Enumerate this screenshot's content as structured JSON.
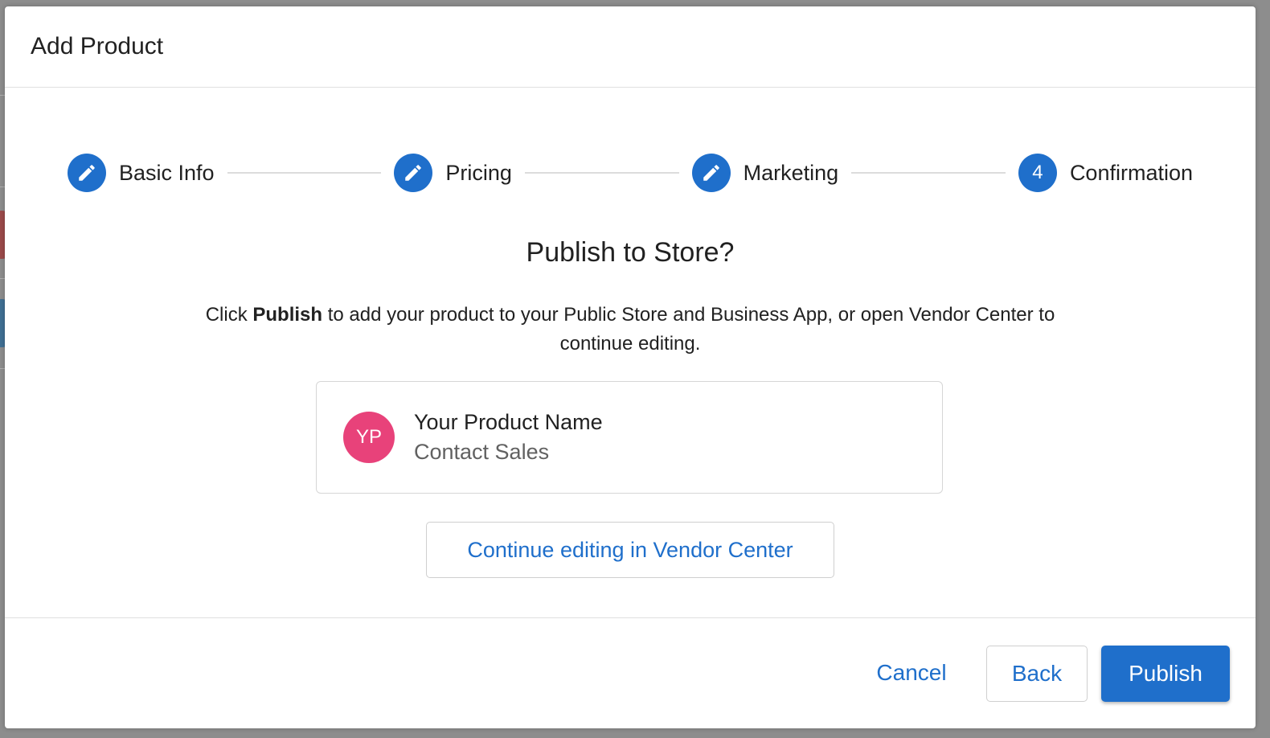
{
  "modal": {
    "title": "Add Product"
  },
  "stepper": {
    "steps": [
      {
        "label": "Basic Info",
        "icon": "pencil-icon",
        "state": "completed"
      },
      {
        "label": "Pricing",
        "icon": "pencil-icon",
        "state": "completed"
      },
      {
        "label": "Marketing",
        "icon": "pencil-icon",
        "state": "completed"
      },
      {
        "label": "Confirmation",
        "number": "4",
        "state": "active"
      }
    ]
  },
  "content": {
    "headline": "Publish to Store?",
    "description_prefix": "Click ",
    "description_bold": "Publish",
    "description_suffix": " to add your product to your Public Store and Business App, or open Vendor Center to continue editing."
  },
  "product_card": {
    "avatar_initials": "YP",
    "name": "Your Product Name",
    "price": "Contact Sales"
  },
  "vendor_button": {
    "label": "Continue editing in Vendor Center"
  },
  "footer": {
    "cancel_label": "Cancel",
    "back_label": "Back",
    "publish_label": "Publish"
  },
  "colors": {
    "accent": "#1f6fcb",
    "avatar": "#e8427a"
  }
}
